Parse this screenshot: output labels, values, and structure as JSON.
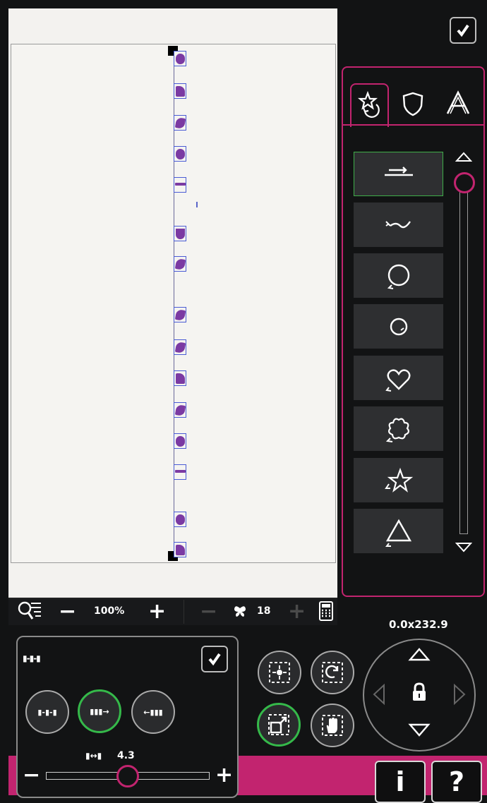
{
  "canvas": {
    "letters": [
      {
        "shape": "oh"
      },
      {
        "shape": "bowl"
      },
      {
        "shape": "ess"
      },
      {
        "shape": "oh"
      },
      {
        "shape": "cross"
      },
      {
        "shape": "vee"
      },
      {
        "shape": "ess"
      },
      {
        "shape": "ess"
      },
      {
        "shape": "ess"
      },
      {
        "shape": "bowl"
      },
      {
        "shape": "ess"
      },
      {
        "shape": "oh"
      },
      {
        "shape": "cross"
      },
      {
        "shape": "oh"
      },
      {
        "shape": "bowl"
      }
    ]
  },
  "toolbar": {
    "zoom_value": "100%",
    "stitch_count": "18",
    "minus": "−",
    "plus": "+"
  },
  "stitch_panel": {
    "tabs": [
      "star-refresh-icon",
      "shield-icon",
      "letter-a-icon"
    ],
    "buttons": [
      {
        "icon": "straight-arrow-icon",
        "selected": true
      },
      {
        "icon": "wave-arrow-icon",
        "selected": false
      },
      {
        "icon": "circle-large-icon",
        "selected": false
      },
      {
        "icon": "circle-small-icon",
        "selected": false
      },
      {
        "icon": "heart-icon",
        "selected": false
      },
      {
        "icon": "flower-icon",
        "selected": false
      },
      {
        "icon": "star-icon",
        "selected": false
      },
      {
        "icon": "triangle-icon",
        "selected": false
      }
    ]
  },
  "position": {
    "readout": "0.0x232.9"
  },
  "text_spacing": {
    "title_icon": "▮-▮-▮",
    "options": [
      "▮-▮-▮",
      "▮▮▮→",
      "←▮▮▮"
    ],
    "value_icon": "▮↔▮",
    "value": "4.3",
    "level": 0.5,
    "minus": "−",
    "plus": "+"
  },
  "accent_color": "#c2246f",
  "selected_color": "#3fae49",
  "help": {
    "info_label": "i",
    "help_label": "?"
  }
}
